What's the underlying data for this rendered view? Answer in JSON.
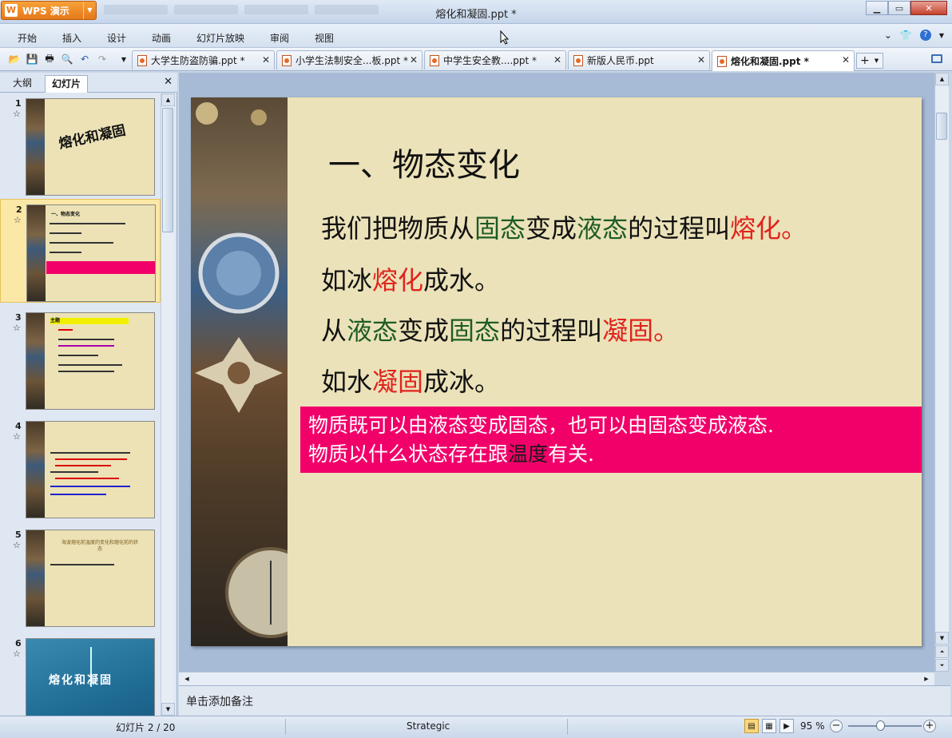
{
  "app": {
    "button_label": "WPS 演示",
    "window_title": "熔化和凝固.ppt *"
  },
  "menu": [
    "开始",
    "插入",
    "设计",
    "动画",
    "幻灯片放映",
    "审阅",
    "视图"
  ],
  "doc_tabs": [
    {
      "label": "大学生防盗防骗.ppt *",
      "active": false
    },
    {
      "label": "小学生法制安全...板.ppt *",
      "active": false
    },
    {
      "label": "中学生安全教....ppt *",
      "active": false
    },
    {
      "label": "新版人民币.ppt",
      "active": false
    },
    {
      "label": "熔化和凝固.ppt *",
      "active": true
    }
  ],
  "left_pane": {
    "tabs": [
      "大纲",
      "幻灯片"
    ],
    "active_tab": "幻灯片",
    "thumbnails": [
      {
        "num": "1",
        "title": "熔化和凝固"
      },
      {
        "num": "2",
        "title": "一、物态变化",
        "selected": true
      },
      {
        "num": "3",
        "title": "主题"
      },
      {
        "num": "4",
        "title": "总结"
      },
      {
        "num": "5",
        "title": "海波熔化前温度的变化和熔化前的状态"
      },
      {
        "num": "6",
        "title": "熔化和凝固"
      }
    ]
  },
  "slide": {
    "title": "一、物态变化",
    "line1": {
      "a": "我们把物质从",
      "b": "固态",
      "c": "变成",
      "d": "液态",
      "e": "的过程叫",
      "f": "熔化。"
    },
    "line2": {
      "a": "如冰",
      "b": "熔化",
      "c": "成水。"
    },
    "line3": {
      "a": "从",
      "b": "液态",
      "c": "变成",
      "d": "固态",
      "e": "的过程叫",
      "f": "凝固。"
    },
    "line4": {
      "a": "如水",
      "b": "凝固",
      "c": "成冰。"
    },
    "box_line1": "物质既可以由液态变成固态，也可以由固态变成液态.",
    "box_line2": {
      "a": "物质以什么状态存在跟",
      "b": "温度",
      "c": "有关."
    }
  },
  "notes_placeholder": "单击添加备注",
  "status": {
    "slide_counter": "幻灯片 2 / 20",
    "theme": "Strategic",
    "zoom": "95 %"
  },
  "colors": {
    "accent_orange": "#e5781a",
    "box_pink": "#f2006a",
    "text_green": "#1e5c24",
    "text_red": "#e0231d"
  }
}
